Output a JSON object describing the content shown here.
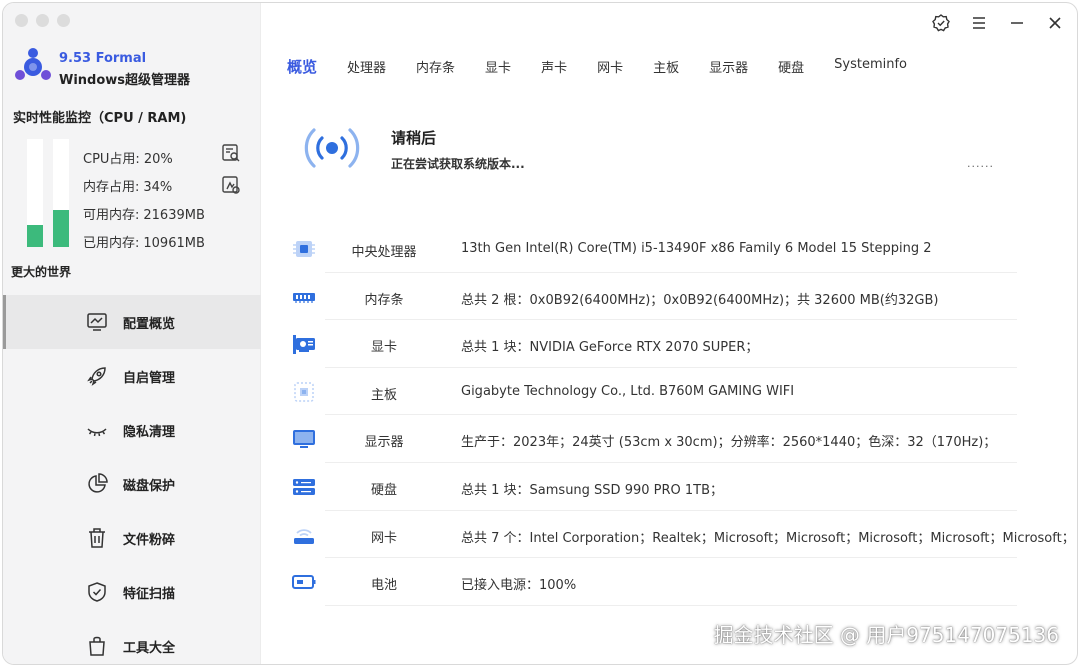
{
  "app": {
    "version": "9.53 Formal",
    "name": "Windows超级管理器"
  },
  "colors": {
    "accent": "#3a5be0",
    "bar_fill": "#3cba7c",
    "icon_blue": "#2f6fde"
  },
  "monitor": {
    "title": "实时性能监控（CPU / RAM)",
    "cpu_label": "CPU占用:",
    "cpu_value": "20%",
    "cpu_fraction": 0.2,
    "mem_label": "内存占用:",
    "mem_value": "34%",
    "mem_fraction": 0.34,
    "avail_label": "可用内存:",
    "avail_value": "21639MB",
    "used_label": "已用内存:",
    "used_value": "10961MB",
    "slogan": "更大的世界"
  },
  "sidebar": {
    "items": [
      {
        "label": "配置概览",
        "icon": "monitor-chart-icon",
        "active": true
      },
      {
        "label": "自启管理",
        "icon": "rocket-icon",
        "active": false
      },
      {
        "label": "隐私清理",
        "icon": "closed-eye-icon",
        "active": false
      },
      {
        "label": "磁盘保护",
        "icon": "pie-chart-icon",
        "active": false
      },
      {
        "label": "文件粉碎",
        "icon": "trash-icon",
        "active": false
      },
      {
        "label": "特征扫描",
        "icon": "shield-check-icon",
        "active": false
      },
      {
        "label": "工具大全",
        "icon": "bag-icon",
        "active": false
      }
    ]
  },
  "tabs": [
    {
      "label": "概览",
      "active": true
    },
    {
      "label": "处理器",
      "active": false
    },
    {
      "label": "内存条",
      "active": false
    },
    {
      "label": "显卡",
      "active": false
    },
    {
      "label": "声卡",
      "active": false
    },
    {
      "label": "网卡",
      "active": false
    },
    {
      "label": "主板",
      "active": false
    },
    {
      "label": "显示器",
      "active": false
    },
    {
      "label": "硬盘",
      "active": false
    },
    {
      "label": "Systeminfo",
      "active": false
    }
  ],
  "status": {
    "title": "请稍后",
    "subtitle": "正在尝试获取系统版本...",
    "dots": "......"
  },
  "info_rows": [
    {
      "label": "中央处理器",
      "value": "13th Gen Intel(R) Core(TM) i5-13490F x86 Family 6 Model 15 Stepping 2",
      "icon": "cpu-icon"
    },
    {
      "label": "内存条",
      "value": "总共 2 根：0x0B92(6400MHz)；0x0B92(6400MHz)；共 32600 MB(约32GB)",
      "icon": "memory-icon"
    },
    {
      "label": "显卡",
      "value": "总共 1 块：NVIDIA GeForce RTX 2070 SUPER；",
      "icon": "gpu-icon"
    },
    {
      "label": "主板",
      "value": "Gigabyte Technology Co., Ltd.  B760M GAMING WIFI",
      "icon": "motherboard-icon"
    },
    {
      "label": "显示器",
      "value": "生产于：2023年；24英寸 (53cm x 30cm)；分辨率：2560*1440；色深：32（170Hz)；",
      "icon": "display-icon"
    },
    {
      "label": "硬盘",
      "value": "总共 1 块：Samsung SSD 990 PRO 1TB；",
      "icon": "disk-icon"
    },
    {
      "label": "网卡",
      "value": "总共 7 个：Intel Corporation；Realtek；Microsoft；Microsoft；Microsoft；Microsoft；Microsoft；",
      "icon": "network-icon"
    },
    {
      "label": "电池",
      "value": "已接入电源：100%",
      "icon": "battery-icon"
    }
  ],
  "watermark": "掘金技术社区 @ 用户975147075136"
}
